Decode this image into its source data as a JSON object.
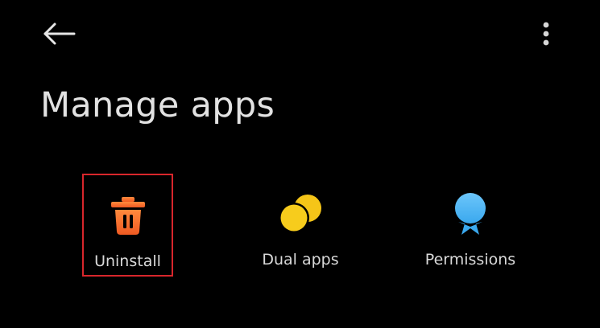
{
  "screen": {
    "title": "Manage apps"
  },
  "top_bar": {
    "back_icon": "arrow-left-icon",
    "more_icon": "more-vertical-icon"
  },
  "tiles": [
    {
      "label": "Uninstall",
      "icon": "trash-icon",
      "icon_color": "#f46a2a",
      "highlighted": true,
      "highlight_color": "#d8262c"
    },
    {
      "label": "Dual apps",
      "icon": "dual-circles-icon",
      "icon_color": "#f5c518"
    },
    {
      "label": "Permissions",
      "icon": "badge-icon",
      "icon_color": "#4fb7f5"
    }
  ]
}
